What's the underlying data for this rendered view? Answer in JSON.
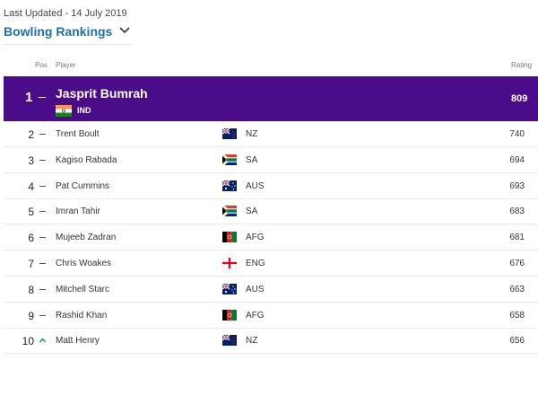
{
  "last_updated": "Last Updated - 14 July 2019",
  "selector": {
    "label": "Bowling Rankings",
    "icon": "chevron-down-icon"
  },
  "columns": {
    "pos": "Pos",
    "player": "Player",
    "rating": "Rating"
  },
  "accent_color": "#4b0c8a",
  "link_color": "#1f6fae",
  "top": {
    "pos": "1",
    "name": "Jasprit Bumrah",
    "team": "IND",
    "rating": "809",
    "flag": "india-flag-icon",
    "movement": "none"
  },
  "rows": [
    {
      "pos": "2",
      "name": "Trent Boult",
      "team": "NZ",
      "rating": "740",
      "flag": "new-zealand-flag-icon",
      "movement": "none"
    },
    {
      "pos": "3",
      "name": "Kagiso Rabada",
      "team": "SA",
      "rating": "694",
      "flag": "south-africa-flag-icon",
      "movement": "none"
    },
    {
      "pos": "4",
      "name": "Pat Cummins",
      "team": "AUS",
      "rating": "693",
      "flag": "australia-flag-icon",
      "movement": "none"
    },
    {
      "pos": "5",
      "name": "Imran Tahir",
      "team": "SA",
      "rating": "683",
      "flag": "south-africa-flag-icon",
      "movement": "none"
    },
    {
      "pos": "6",
      "name": "Mujeeb Zadran",
      "team": "AFG",
      "rating": "681",
      "flag": "afghanistan-flag-icon",
      "movement": "none"
    },
    {
      "pos": "7",
      "name": "Chris Woakes",
      "team": "ENG",
      "rating": "676",
      "flag": "england-flag-icon",
      "movement": "none"
    },
    {
      "pos": "8",
      "name": "Mitchell Starc",
      "team": "AUS",
      "rating": "663",
      "flag": "australia-flag-icon",
      "movement": "none"
    },
    {
      "pos": "9",
      "name": "Rashid Khan",
      "team": "AFG",
      "rating": "658",
      "flag": "afghanistan-flag-icon",
      "movement": "none"
    },
    {
      "pos": "10",
      "name": "Matt Henry",
      "team": "NZ",
      "rating": "656",
      "flag": "new-zealand-flag-icon",
      "movement": "up"
    }
  ]
}
